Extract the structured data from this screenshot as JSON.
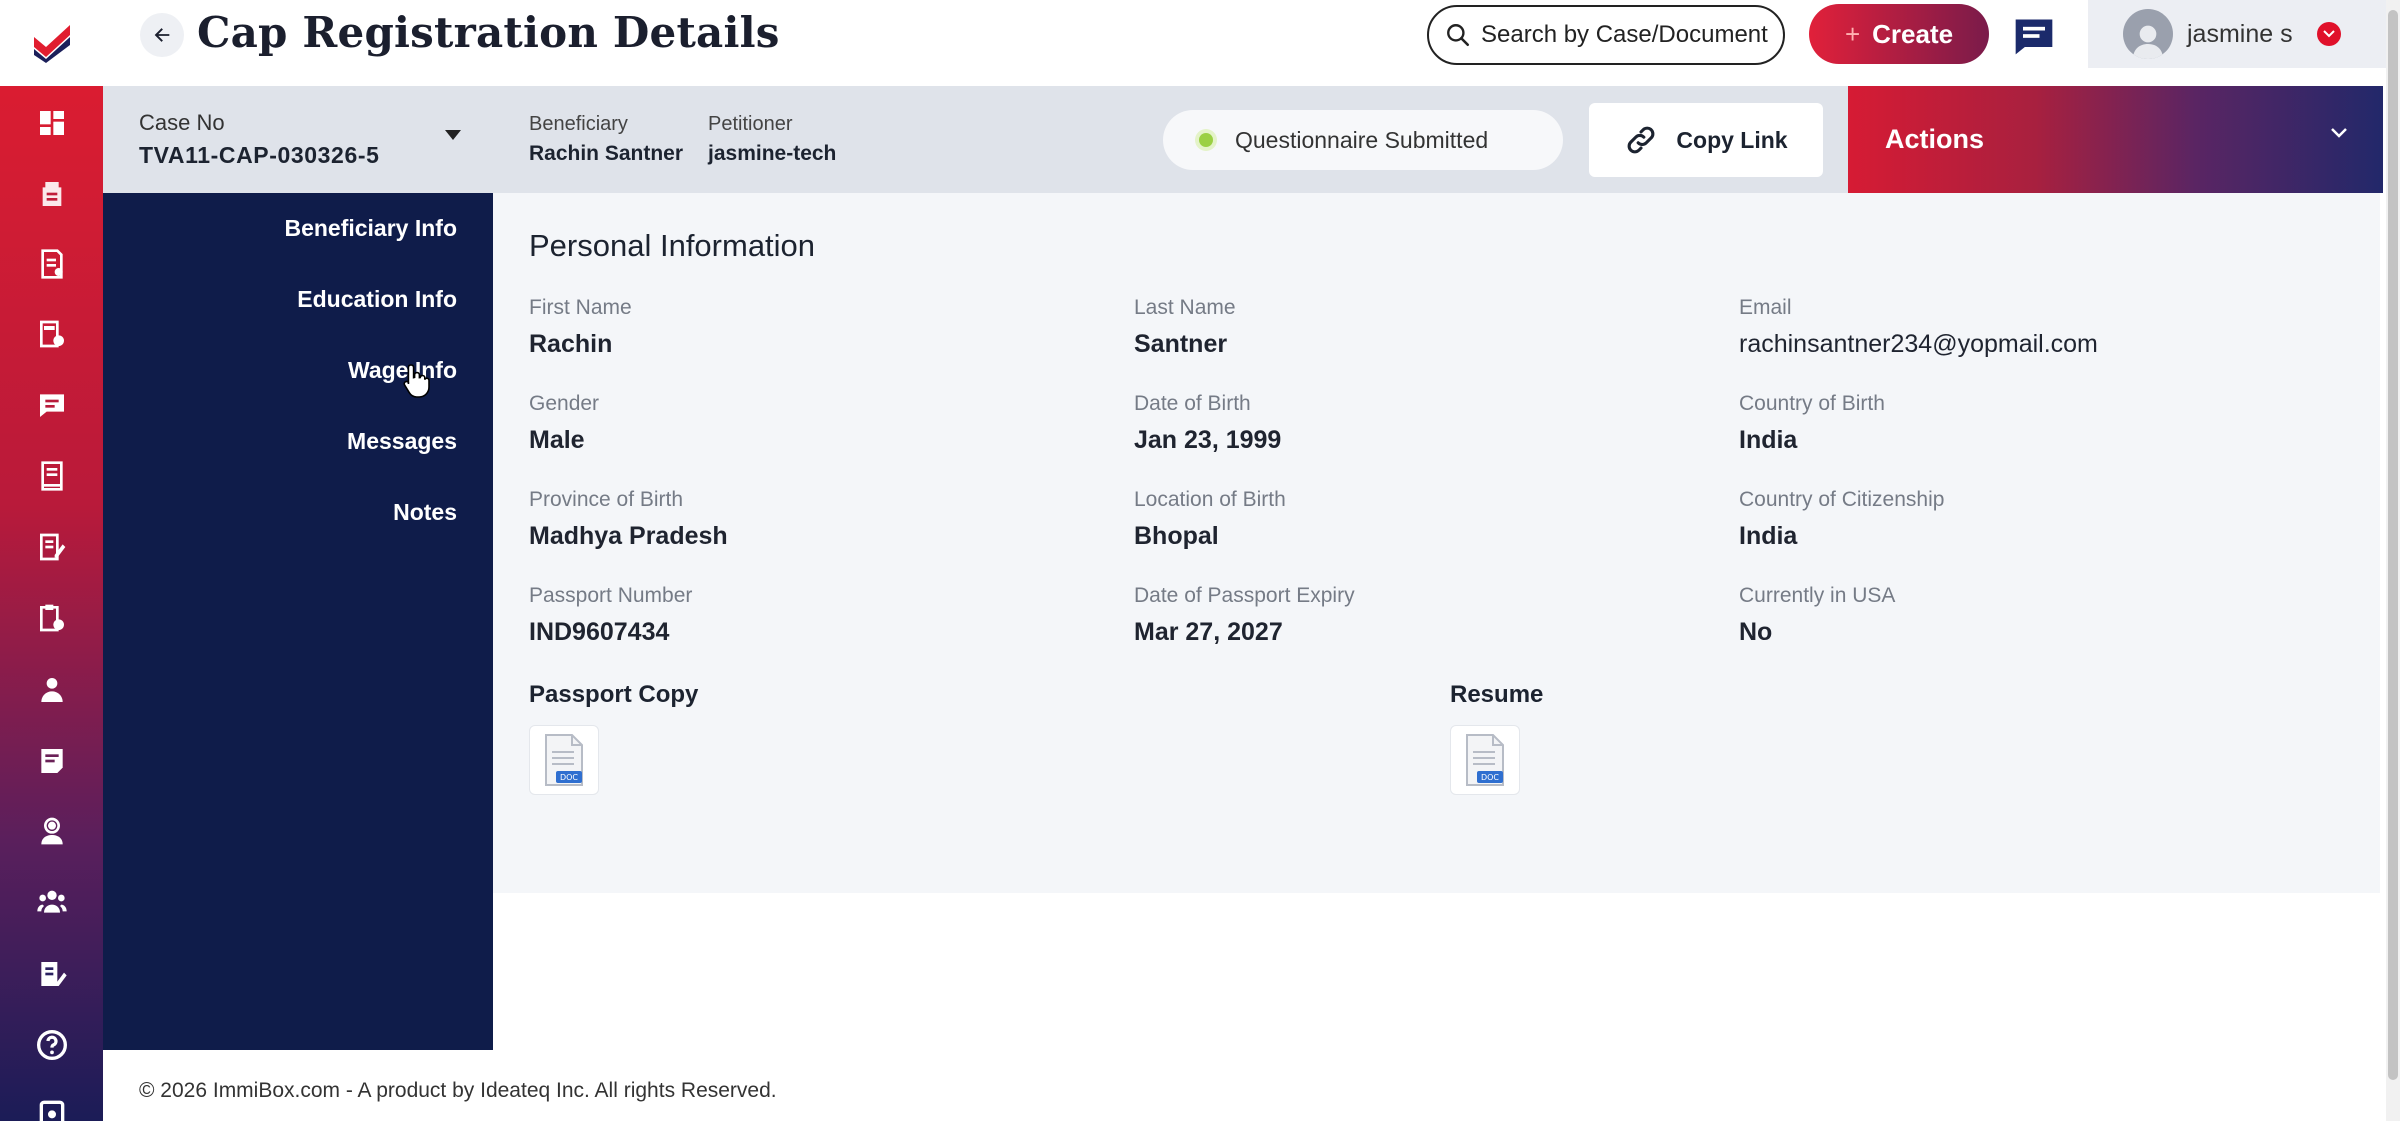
{
  "header": {
    "title": "Cap Registration Details",
    "search_placeholder": "Search by Case/Document",
    "create_label": "Create",
    "create_icon": "plus-icon",
    "user_name": "jasmine s"
  },
  "case": {
    "case_no_label": "Case No",
    "case_no": "TVA11-CAP-030326-5",
    "beneficiary_label": "Beneficiary",
    "beneficiary": "Rachin Santner",
    "petitioner_label": "Petitioner",
    "petitioner": "jasmine-tech",
    "status": "Questionnaire Submitted",
    "copy_link_label": "Copy Link",
    "actions_label": "Actions"
  },
  "subnav": {
    "items": [
      {
        "label": "Beneficiary Info"
      },
      {
        "label": "Education Info"
      },
      {
        "label": "Wage Info"
      },
      {
        "label": "Messages"
      },
      {
        "label": "Notes"
      }
    ]
  },
  "personal": {
    "title": "Personal Information",
    "fields": [
      {
        "label": "First Name",
        "value": "Rachin"
      },
      {
        "label": "Last Name",
        "value": "Santner"
      },
      {
        "label": "Email",
        "value": "rachinsantner234@yopmail.com"
      },
      {
        "label": "Gender",
        "value": "Male"
      },
      {
        "label": "Date of Birth",
        "value": "Jan 23, 1999"
      },
      {
        "label": "Country of Birth",
        "value": "India"
      },
      {
        "label": "Province of Birth",
        "value": "Madhya Pradesh"
      },
      {
        "label": "Location of Birth",
        "value": "Bhopal"
      },
      {
        "label": "Country of Citizenship",
        "value": "India"
      },
      {
        "label": "Passport Number",
        "value": "IND9607434"
      },
      {
        "label": "Date of Passport Expiry",
        "value": "Mar 27, 2027"
      },
      {
        "label": "Currently in USA",
        "value": "No"
      }
    ],
    "documents": [
      {
        "title": "Passport Copy",
        "icon": "doc-file-icon"
      },
      {
        "title": "Resume",
        "icon": "doc-file-icon"
      }
    ]
  },
  "footer": {
    "text": "© 2026 ImmiBox.com - A product by Ideateq Inc. All rights Reserved."
  },
  "colors": {
    "brand_red": "#e11d2f",
    "navy": "#0f1c4a",
    "status_green": "#9bd043"
  }
}
